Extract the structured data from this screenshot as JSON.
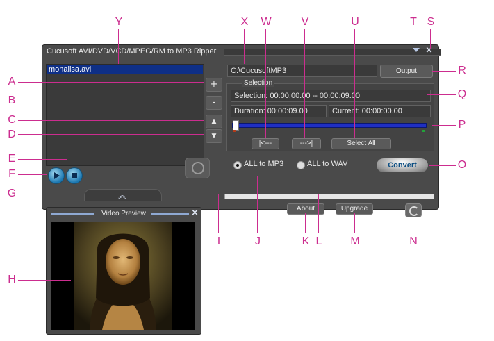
{
  "window": {
    "title": "Cucusoft AVI/DVD/VCD/MPEG/RM to MP3 Ripper"
  },
  "file_list": {
    "items": [
      "monalisa.avi"
    ]
  },
  "side_buttons": {
    "add": "+",
    "remove": "-",
    "up": "▲",
    "down": "▼"
  },
  "output": {
    "path": "C:\\CucusoftMP3",
    "button_label": "Output"
  },
  "selection": {
    "group_label": "Selection",
    "range": "Selection: 00:00:00.00 -- 00:00:09.00",
    "duration": "Duration: 00:00:09.00",
    "current": "Current: 00:00:00.00",
    "start_button": "|<---",
    "end_button": "--->|",
    "select_all_button": "Select All",
    "slider_position": 0.0
  },
  "format": {
    "mp3_label": "ALL to MP3",
    "wav_label": "ALL to WAV",
    "selected": "mp3"
  },
  "convert_button": "Convert",
  "footer": {
    "about": "About",
    "upgrade": "Upgrade"
  },
  "preview": {
    "title": "Video Preview"
  },
  "callouts": [
    "A",
    "B",
    "C",
    "D",
    "E",
    "F",
    "G",
    "H",
    "I",
    "J",
    "K",
    "L",
    "M",
    "N",
    "O",
    "P",
    "Q",
    "R",
    "S",
    "T",
    "U",
    "V",
    "W",
    "X",
    "Y"
  ],
  "colors": {
    "callout": "#cc2d8f",
    "window_bg": "#4a4a4a",
    "selection_highlight": "#0e2f87",
    "slider": "#1f2fc2"
  }
}
